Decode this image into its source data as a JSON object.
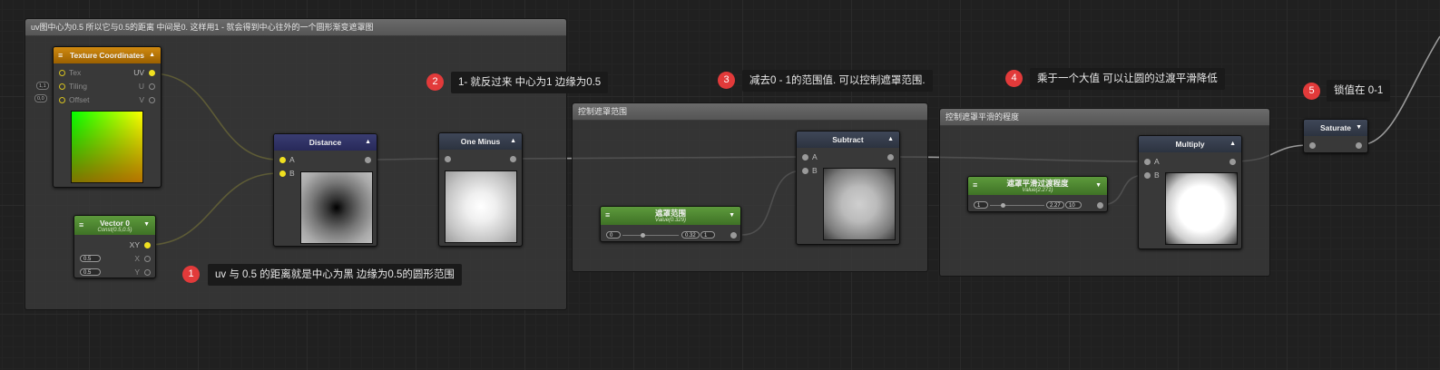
{
  "groups": {
    "uv": {
      "title": "uv图中心为0.5 所以它与0.5的距离 中间是0. 这样用1 - 就会得到中心往外的一个圆形渐变遮罩图"
    },
    "mask_range": {
      "title": "控制遮罩范围"
    },
    "mask_smooth": {
      "title": "控制遮罩平滑的程度"
    }
  },
  "nodes": {
    "texcoord": {
      "title": "Texture Coordinates",
      "ports_in": [
        "Tex",
        "Tiling",
        "Offset"
      ],
      "ports_out": [
        "UV",
        "U",
        "V"
      ],
      "tiling_badge": "1,1",
      "offset_badge": "0,0"
    },
    "vector0": {
      "title": "Vector 0",
      "subtitle": "Const(0.5,0.5)",
      "ports_out": [
        "XY",
        "X",
        "Y"
      ],
      "x_val": "0.5",
      "y_val": "0.5"
    },
    "distance": {
      "title": "Distance",
      "in_a": "A",
      "in_b": "B"
    },
    "oneminus": {
      "title": "One Minus"
    },
    "maskrange": {
      "title": "遮罩范围",
      "subtitle": "Value(0.329)",
      "min": "0",
      "value": "0.32",
      "max": "1"
    },
    "subtract": {
      "title": "Subtract",
      "in_a": "A",
      "in_b": "B"
    },
    "masksmooth": {
      "title": "遮罩平滑过渡程度",
      "subtitle": "Value(2.271)",
      "min": "1",
      "value": "2.27",
      "max": "10"
    },
    "multiply": {
      "title": "Multiply",
      "in_a": "A",
      "in_b": "B"
    },
    "saturate": {
      "title": "Saturate"
    }
  },
  "notes": [
    {
      "num": "1",
      "text": "uv 与 0.5 的距离就是中心为黑 边缘为0.5的圆形范围"
    },
    {
      "num": "2",
      "text": "1- 就反过来 中心为1 边缘为0.5"
    },
    {
      "num": "3",
      "text": "减去0 - 1的范围值. 可以控制遮罩范围."
    },
    {
      "num": "4",
      "text": "乘于一个大值 可以让圆的过渡平滑降低"
    },
    {
      "num": "5",
      "text": "锁值在 0-1"
    }
  ],
  "colors": {
    "wire_yellow": "#d9cf2a",
    "wire_grey": "#9a9a9a",
    "badge_red": "#e23a3a",
    "header_green": "#4f8a30",
    "header_orange": "#c07a00"
  }
}
